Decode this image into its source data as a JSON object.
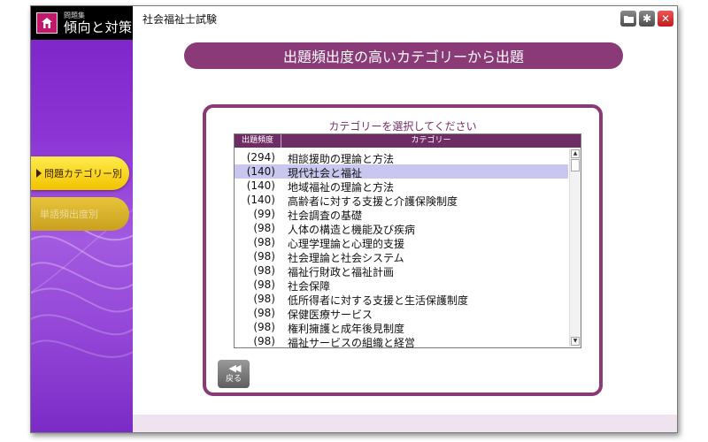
{
  "app": {
    "logo_subtitle": "問題集",
    "logo_title": "傾向と対策",
    "window_title": "社会福祉士試験"
  },
  "window_buttons": [
    {
      "icon": "folder-icon",
      "glyph": "▬"
    },
    {
      "icon": "gear-icon",
      "glyph": "✱"
    },
    {
      "icon": "close-icon",
      "glyph": "✕"
    }
  ],
  "sidebar": {
    "items": [
      {
        "label": "問題カテゴリー別",
        "active": true
      },
      {
        "label": "単語頻出度別",
        "active": false
      }
    ]
  },
  "header": {
    "title": "出題頻出度の高いカテゴリーから出題"
  },
  "panel": {
    "title": "カテゴリーを選択してください",
    "columns": [
      "出題頻度",
      "カテゴリー"
    ],
    "rows": [
      {
        "count": "(294)",
        "category": "相談援助の理論と方法"
      },
      {
        "count": "(140)",
        "category": "現代社会と福祉",
        "selected": true
      },
      {
        "count": "(140)",
        "category": "地域福祉の理論と方法"
      },
      {
        "count": "(140)",
        "category": "高齢者に対する支援と介護保険制度"
      },
      {
        "count": "(99)",
        "category": "社会調査の基礎"
      },
      {
        "count": "(98)",
        "category": "人体の構造と機能及び疾病"
      },
      {
        "count": "(98)",
        "category": "心理学理論と心理的支援"
      },
      {
        "count": "(98)",
        "category": "社会理論と社会システム"
      },
      {
        "count": "(98)",
        "category": "福祉行財政と福祉計画"
      },
      {
        "count": "(98)",
        "category": "社会保障"
      },
      {
        "count": "(98)",
        "category": "低所得者に対する支援と生活保護制度"
      },
      {
        "count": "(98)",
        "category": "保健医療サービス"
      },
      {
        "count": "(98)",
        "category": "権利擁護と成年後見制度"
      },
      {
        "count": "(98)",
        "category": "福祉サービスの組織と経営"
      }
    ]
  },
  "back_button": {
    "label": "戻る",
    "icon": "rewind-icon"
  },
  "colors": {
    "accent": "#8a3a77",
    "selected_row": "#c9c7ef",
    "sidebar_active": "#f2c200",
    "sidebar_bg": "#8c34d4"
  }
}
